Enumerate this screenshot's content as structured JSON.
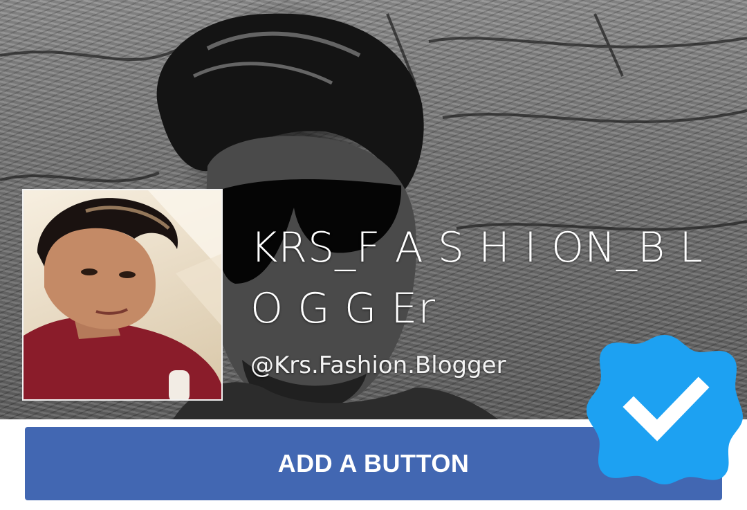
{
  "profile": {
    "page_name": "KRS_F A S H I ON_B L O G G Er",
    "username": "@Krs.Fashion.Blogger"
  },
  "action": {
    "button_label": "ADD A BUTTON"
  },
  "icons": {
    "verified": "verified-check-icon"
  },
  "colors": {
    "button_bg": "#4267b2",
    "button_text": "#ffffff",
    "verified_badge": "#1da1f2",
    "name_text": "#ffffff"
  }
}
